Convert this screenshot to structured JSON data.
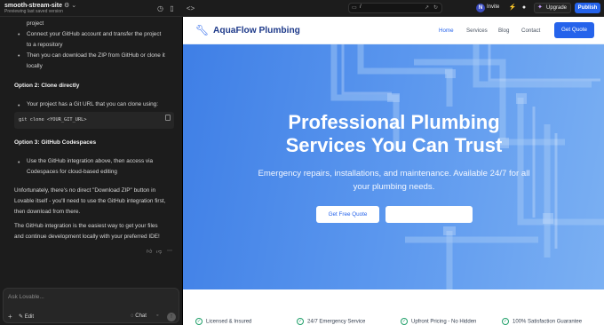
{
  "topbar": {
    "project_name": "smooth-stream-site",
    "project_subtitle": "Previewing last saved version",
    "url_path": "/",
    "invite_label": "Invite",
    "avatar_initial": "N",
    "upgrade_label": "Upgrade",
    "publish_label": "Publish"
  },
  "chat": {
    "lines": [
      "project",
      "Connect your GitHub account and transfer the project",
      "to a repository",
      "Then you can download the ZIP from GitHub or clone it",
      "locally",
      "Option 2: Clone directly",
      "Your project has a Git URL that you can clone using:",
      "git clone <YOUR_GIT_URL>",
      "Option 3: GitHub Codespaces",
      "Use the GitHub integration above, then access via",
      "Codespaces for cloud-based editing",
      "Unfortunately, there's no direct \"Download ZIP\" button in",
      "Lovable itself - you'll need to use the GitHub integration first,",
      "then download from there.",
      "The GitHub integration is the easiest way to get your files",
      "and continue development locally with your preferred IDE!"
    ],
    "composer_placeholder": "Ask Lovable...",
    "edit_label": "Edit",
    "chat_label": "Chat"
  },
  "site": {
    "brand": "AquaFlow Plumbing",
    "nav": [
      "Home",
      "Services",
      "Blog",
      "Contact"
    ],
    "nav_cta": "Get Quote",
    "hero_title_line1": "Professional Plumbing",
    "hero_title_line2": "Services You Can Trust",
    "hero_sub_line1": "Emergency repairs, installations, and maintenance. Available 24/7 for all",
    "hero_sub_line2": "your plumbing needs.",
    "hero_btn1": "Get Free Quote",
    "features": [
      "Licensed & Insured",
      "24/7 Emergency Service",
      "Upfront Pricing - No Hidden",
      "100% Satisfaction Guarantee"
    ]
  },
  "colors": {
    "accent": "#2563eb",
    "brand_text": "#1e3a8a",
    "hero_from": "#3f7fe6",
    "hero_to": "#7bb0f3"
  }
}
